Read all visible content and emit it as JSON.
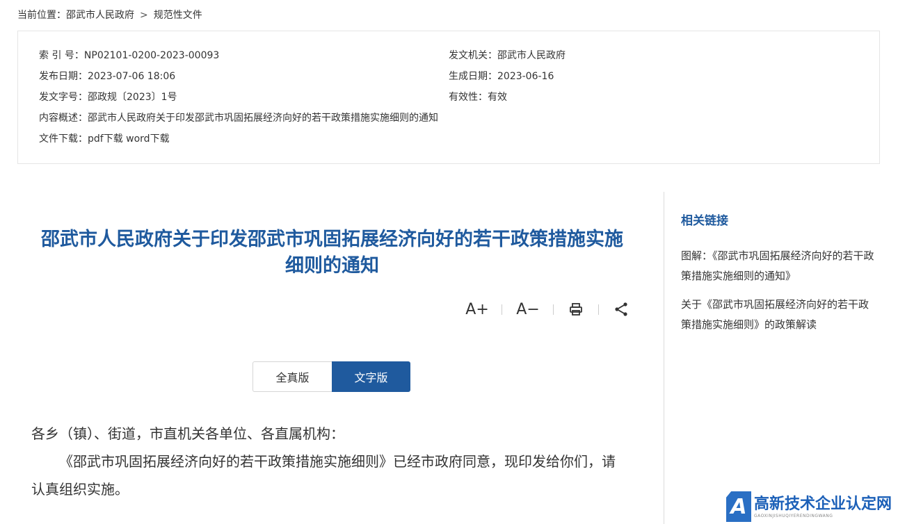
{
  "breadcrumb": {
    "prefix": "当前位置：",
    "items": [
      "邵武市人民政府",
      "规范性文件"
    ],
    "separator": ">"
  },
  "meta": {
    "index_label": "索 引 号：",
    "index_value": "NP02101-0200-2023-00093",
    "issuer_label": "发文机关：",
    "issuer_value": "邵武市人民政府",
    "publish_label": "发布日期：",
    "publish_value": "2023-07-06 18:06",
    "generate_label": "生成日期：",
    "generate_value": "2023-06-16",
    "docno_label": "发文字号：",
    "docno_value": "邵政规〔2023〕1号",
    "validity_label": "有效性：",
    "validity_value": "有效",
    "summary_label": "内容概述：",
    "summary_value": "邵武市人民政府关于印发邵武市巩固拓展经济向好的若干政策措施实施细则的通知",
    "download_label": "文件下载：",
    "download_pdf": "pdf下载",
    "download_word": "word下载"
  },
  "document": {
    "title": "邵武市人民政府关于印发邵武市巩固拓展经济向好的若干政策措施实施细则的通知",
    "paragraph1": "各乡（镇）、街道，市直机关各单位、各直属机构：",
    "paragraph2": "《邵武市巩固拓展经济向好的若干政策措施实施细则》已经市政府同意，现印发给你们，请认真组织实施。"
  },
  "tools": {
    "font_increase": "A+",
    "font_decrease": "A−",
    "print_icon": "print-icon",
    "share_icon": "share-icon"
  },
  "tabs": {
    "full": "全真版",
    "text": "文字版"
  },
  "sidebar": {
    "title": "相关链接",
    "links": [
      "图解：《邵武市巩固拓展经济向好的若干政策措施实施细则的通知》",
      "关于《邵武市巩固拓展经济向好的若干政策措施实施细则》的政策解读"
    ]
  },
  "watermark": {
    "mark": "A",
    "cn": "高新技术企业认定网",
    "en": "GAOXINJISHUQIYERENDINGWANG"
  },
  "colors": {
    "accent": "#1f5a9e",
    "border": "#e5e5e5"
  }
}
